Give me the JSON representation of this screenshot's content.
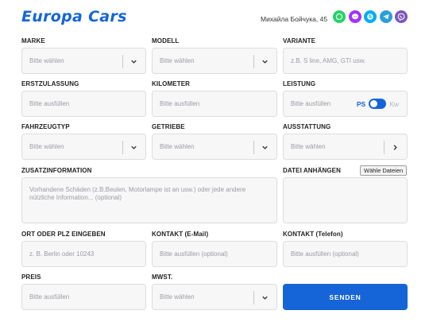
{
  "header": {
    "logo": "Europa Cars",
    "address": "Михайла Бойчука, 45",
    "social": [
      {
        "icon": "whatsapp-icon",
        "color": "#25d366"
      },
      {
        "icon": "messenger-icon",
        "color": "#a334fa"
      },
      {
        "icon": "skype-icon",
        "color": "#00aff0"
      },
      {
        "icon": "telegram-icon",
        "color": "#2a9fd8"
      },
      {
        "icon": "viber-icon",
        "color": "#7d56b8"
      }
    ]
  },
  "form": {
    "marke": {
      "label": "MARKE",
      "placeholder": "Bitte wählen"
    },
    "modell": {
      "label": "MODELL",
      "placeholder": "Bitte wählen"
    },
    "variante": {
      "label": "VARIANTE",
      "placeholder": "z.B. S line, AMG, GTI usw."
    },
    "erstzulassung": {
      "label": "ERSTZULASSUNG",
      "placeholder": "Bitte ausfüllen"
    },
    "kilometer": {
      "label": "KILOMETER",
      "placeholder": "Bitte ausfüllen"
    },
    "leistung": {
      "label": "LEISTUNG",
      "placeholder": "Bitte ausfüllen",
      "unit_on": "PS",
      "unit_off": "Kw"
    },
    "fahrzeugtyp": {
      "label": "FAHRZEUGTYP",
      "placeholder": "Bitte wählen"
    },
    "getriebe": {
      "label": "GETRIEBE",
      "placeholder": "Bitte wählen"
    },
    "ausstattung": {
      "label": "AUSSTATTUNG",
      "placeholder": "Bitte wählen"
    },
    "zusatz": {
      "label": "ZUSATZINFORMATION",
      "placeholder": "Vorhandene Schäden (z.B.Beulen, Motorlampe ist an usw.) oder jede andere nützliche Information... (optional)"
    },
    "datei": {
      "label": "DATEI ANHÄNGEN",
      "button": "Wähle Dateien"
    },
    "ort": {
      "label": "ORT ODER PLZ EINGEBEN",
      "placeholder": "z. B. Berlin oder 10243"
    },
    "email": {
      "label": "KONTAKT (E-Mail)",
      "placeholder": "Bitte ausfüllen (optional)"
    },
    "telefon": {
      "label": "KONTAKT (Telefon)",
      "placeholder": "Bitte ausfüllen (optional)"
    },
    "preis": {
      "label": "PREIS",
      "placeholder": "Bitte ausfüllen"
    },
    "mwst": {
      "label": "MWST.",
      "placeholder": "Bitte wählen"
    },
    "send": "SENDEN"
  },
  "colors": {
    "accent": "#1565d8",
    "field_bg": "#f7f7f8",
    "border": "#dcdde0"
  }
}
